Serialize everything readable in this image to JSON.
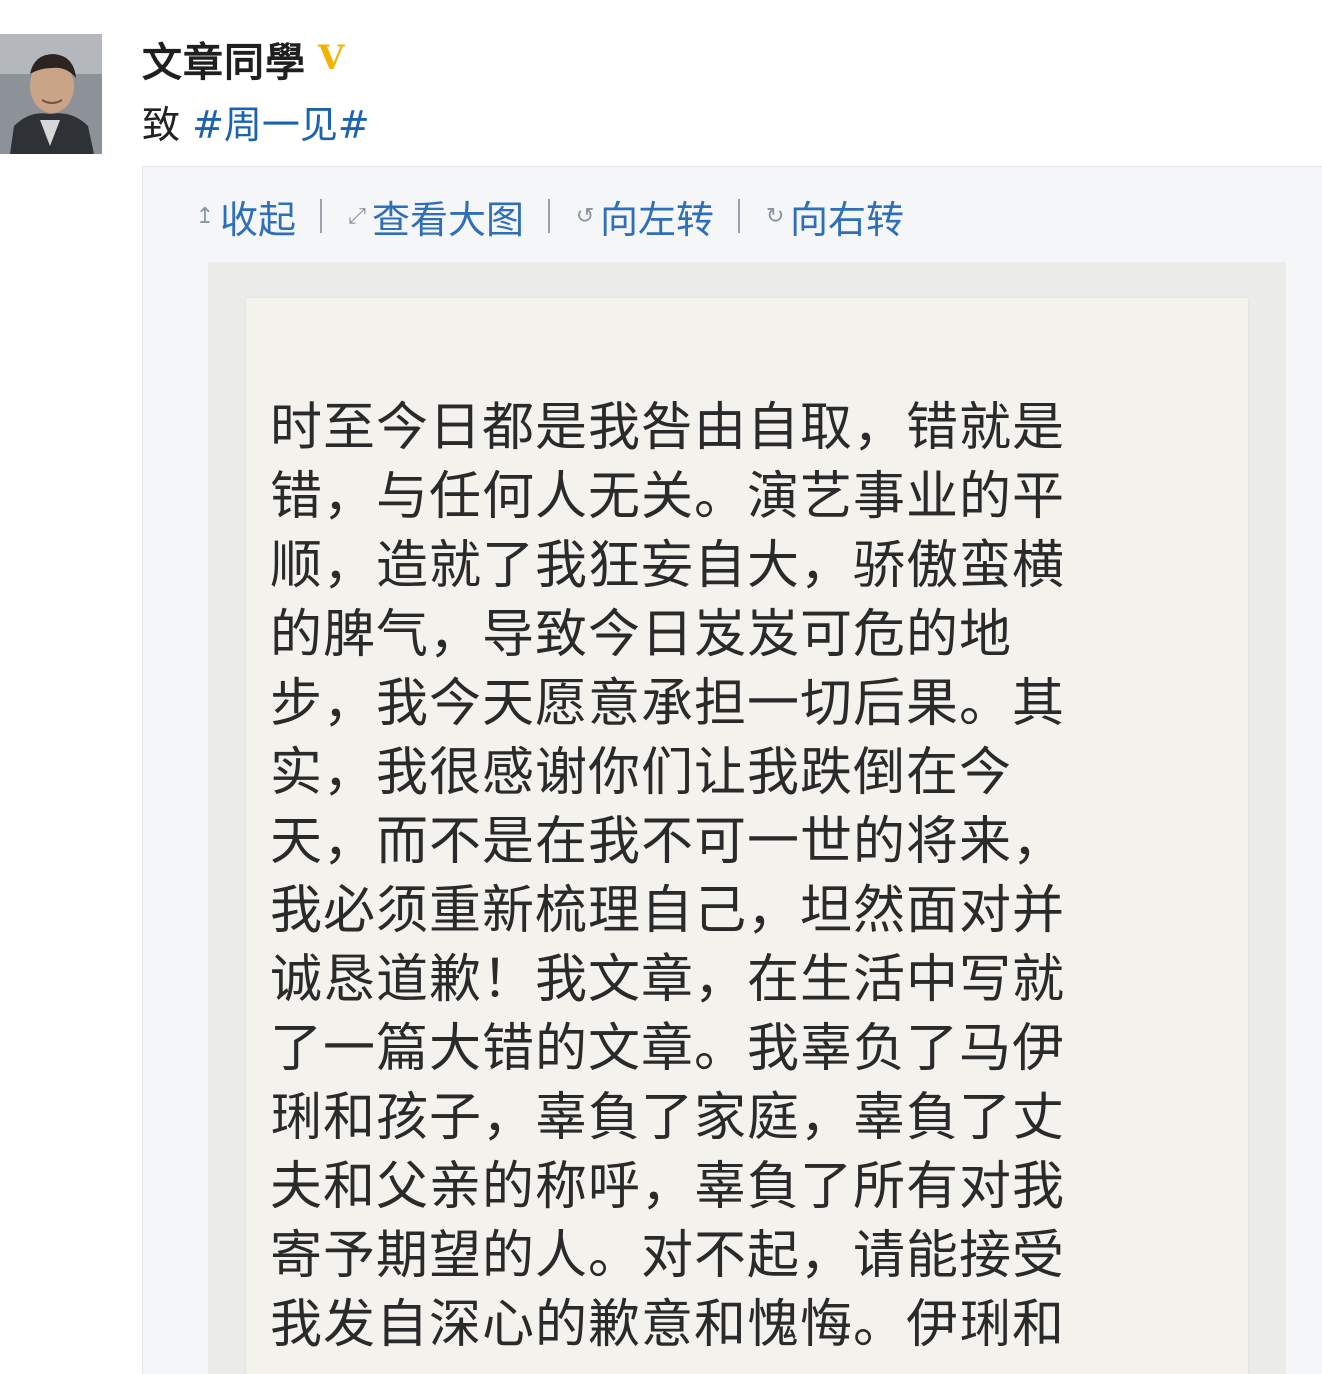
{
  "post": {
    "username": "文章同學",
    "verified_badge": "V",
    "prefix": "致 ",
    "hashtag": "#周一见#"
  },
  "toolbar": {
    "collapse": "收起",
    "view_large": "查看大图",
    "rotate_left": "向左转",
    "rotate_right": "向右转",
    "icons": [
      "arrow-up-icon",
      "zoom-icon",
      "rotate-left-icon",
      "rotate-right-icon"
    ]
  },
  "statement": {
    "lines": [
      "时至今日都是我咎由自取，错就是",
      "错，与任何人无关。演艺事业的平",
      "顺，造就了我狂妄自大，骄傲蛮横",
      "的脾气，导致今日岌岌可危的地",
      "步，我今天愿意承担一切后果。其",
      "实，我很感谢你们让我跌倒在今",
      "天，而不是在我不可一世的将来，",
      "我必须重新梳理自己，坦然面对并",
      "诚恳道歉！我文章，在生活中写就",
      "了一篇大错的文章。我辜负了马伊",
      "琍和孩子，辜負了家庭，辜負了丈",
      "夫和父亲的称呼，辜負了所有对我",
      "寄予期望的人。对不起，请能接受",
      "我发自深心的歉意和愧悔。伊琍和"
    ]
  },
  "colors": {
    "link": "#2f6fb8",
    "hashtag": "#1b63b0",
    "verified": "#f2b200"
  }
}
